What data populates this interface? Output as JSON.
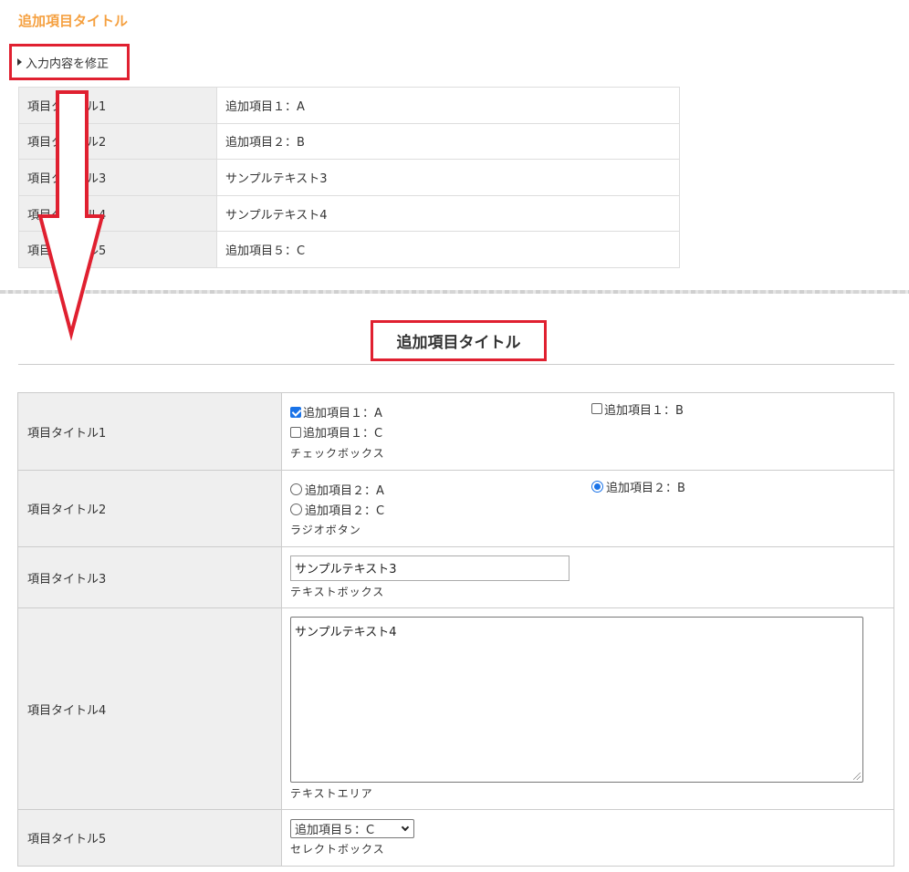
{
  "confirm": {
    "title": "追加項目タイトル",
    "edit_link": "入力内容を修正",
    "rows": [
      {
        "label": "項目タイトル1",
        "value": "追加項目１：A"
      },
      {
        "label": "項目タイトル2",
        "value": "追加項目２：B"
      },
      {
        "label": "項目タイトル3",
        "value": "サンプルテキスト3"
      },
      {
        "label": "項目タイトル4",
        "value": "サンプルテキスト4"
      },
      {
        "label": "項目タイトル5",
        "value": "追加項目５：C"
      }
    ]
  },
  "form": {
    "title": "追加項目タイトル",
    "rows": [
      {
        "label": "項目タイトル1",
        "options": [
          {
            "label": "追加項目１：A",
            "checked": true
          },
          {
            "label": "追加項目１：B",
            "checked": false
          },
          {
            "label": "追加項目１：C",
            "checked": false
          }
        ],
        "hint": "チェックボックス"
      },
      {
        "label": "項目タイトル2",
        "options": [
          {
            "label": "追加項目２：A",
            "checked": false
          },
          {
            "label": "追加項目２：B",
            "checked": true
          },
          {
            "label": "追加項目２：C",
            "checked": false
          }
        ],
        "hint": "ラジオボタン"
      },
      {
        "label": "項目タイトル3",
        "value": "サンプルテキスト3",
        "hint": "テキストボックス"
      },
      {
        "label": "項目タイトル4",
        "value": "サンプルテキスト4",
        "hint": "テキストエリア"
      },
      {
        "label": "項目タイトル5",
        "value": "追加項目５：C",
        "hint": "セレクトボックス"
      }
    ]
  },
  "colors": {
    "title_orange": "#f5a040",
    "highlight_red": "#e02030",
    "checked_blue": "#1a73e8"
  }
}
